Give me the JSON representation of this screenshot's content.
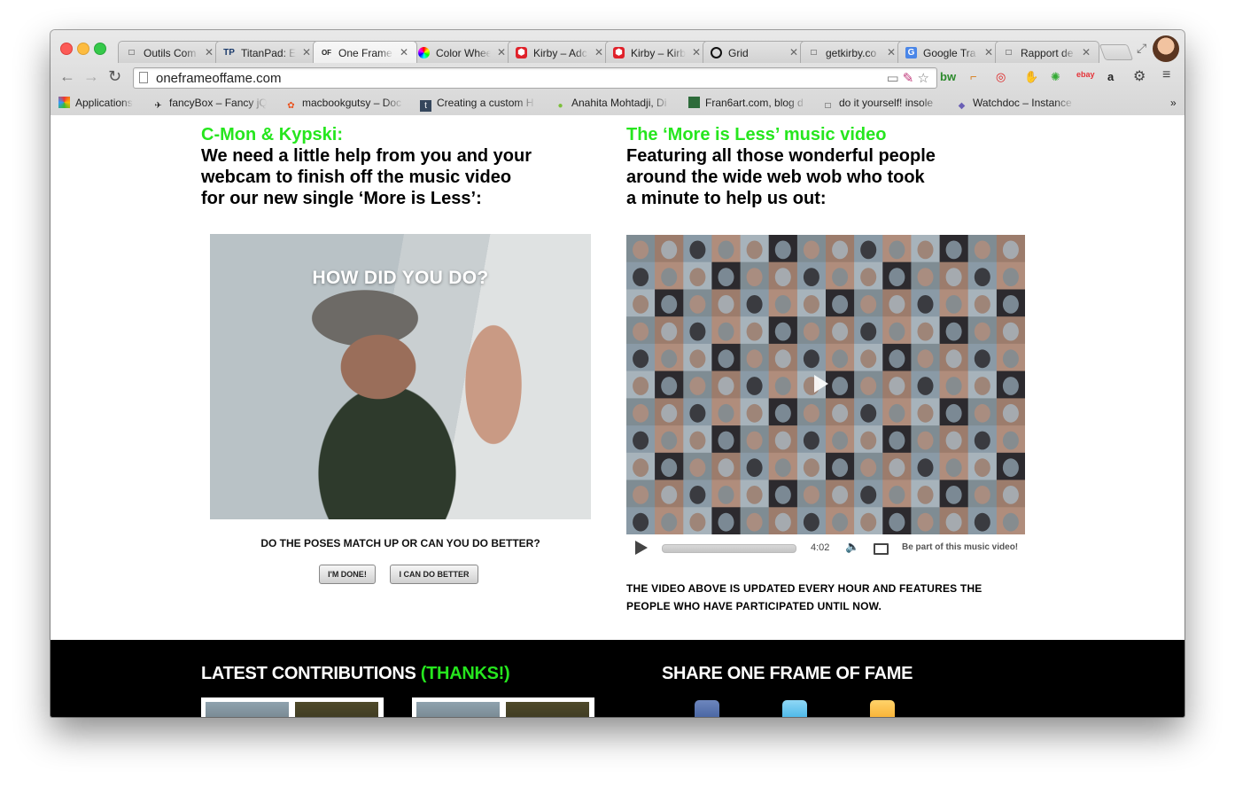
{
  "browser": {
    "tabs": [
      {
        "title": "Outils Com",
        "icon": "page-icon"
      },
      {
        "title": "TitanPad: E",
        "icon": "titanpad-icon",
        "favtext": "TP"
      },
      {
        "title": "One Frame",
        "icon": "oneframe-icon",
        "favtext": "OF",
        "active": true
      },
      {
        "title": "Color Whee",
        "icon": "color-wheel-icon"
      },
      {
        "title": "Kirby – Adc",
        "icon": "kirby-icon"
      },
      {
        "title": "Kirby – Kirb",
        "icon": "kirby-icon"
      },
      {
        "title": "Grid",
        "icon": "grid-icon"
      },
      {
        "title": "getkirby.co",
        "icon": "page-icon"
      },
      {
        "title": "Google Tra",
        "icon": "google-translate-icon"
      },
      {
        "title": "Rapport de",
        "icon": "page-icon"
      }
    ],
    "url": "oneframeoffame.com",
    "bookmarks": [
      {
        "label": "Applications",
        "icon": "apps-grid-icon"
      },
      {
        "label": "fancyBox – Fancy jQ",
        "icon": "fancybox-icon"
      },
      {
        "label": "macbookgutsy – Doc",
        "icon": "ubuntu-icon"
      },
      {
        "label": "Creating a custom H",
        "icon": "tumblr-icon"
      },
      {
        "label": "Anahita Mohtadji, Di",
        "icon": "apple-icon"
      },
      {
        "label": "Fran6art.com, blog d",
        "icon": "blog-icon"
      },
      {
        "label": "do it yourself! insole",
        "icon": "page-icon"
      },
      {
        "label": "Watchdoc – Instance",
        "icon": "watchdoc-icon"
      }
    ],
    "more_bookmarks": "»"
  },
  "left": {
    "kicker": "C-Mon & Kypski:",
    "headline": [
      "We need a little help from you and your",
      "webcam to finish off the music video",
      "for our new single ‘More is Less’:"
    ],
    "overlay": "HOW DID YOU DO?",
    "question": "DO THE POSES MATCH UP OR CAN YOU DO BETTER?",
    "btn_done": "I'M DONE!",
    "btn_better": "I CAN DO BETTER"
  },
  "right": {
    "kicker": "The ‘More is Less’ music video",
    "headline": [
      "Featuring all those wonderful people",
      "around the wide web wob who took",
      "a minute to help us out:"
    ],
    "duration": "4:02",
    "bepart": "Be part of this music video!",
    "note": [
      "THE VIDEO ABOVE IS UPDATED EVERY HOUR AND FEATURES THE",
      "PEOPLE WHO HAVE PARTICIPATED UNTIL NOW."
    ]
  },
  "footer": {
    "latest": "LATEST CONTRIBUTIONS",
    "thanks": "(THANKS!)",
    "share": "SHARE ONE FRAME OF FAME"
  },
  "colors": {
    "accent_green": "#26e61e",
    "footer_bg": "#000000"
  }
}
